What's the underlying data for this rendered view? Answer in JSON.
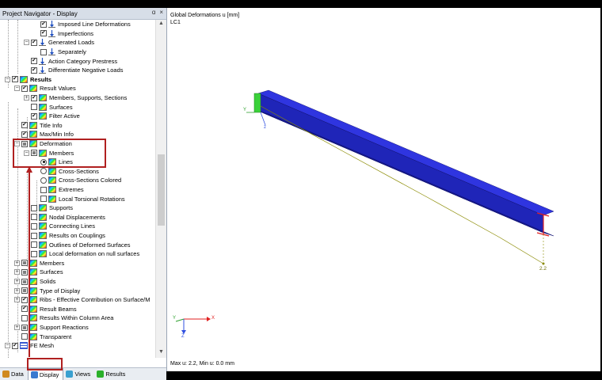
{
  "navigator": {
    "title": "Project Navigator - Display",
    "pin_glyph": "ɑ",
    "close_glyph": "×",
    "tree": [
      {
        "label": "Imposed Line Deformations",
        "depth": 3,
        "expander": "",
        "check": "on",
        "icon": "load",
        "bold": false
      },
      {
        "label": "Imperfections",
        "depth": 3,
        "expander": "",
        "check": "on",
        "icon": "load",
        "bold": false
      },
      {
        "label": "Generated Loads",
        "depth": 2,
        "expander": "-",
        "check": "on",
        "icon": "load",
        "bold": false
      },
      {
        "label": "Separately",
        "depth": 3,
        "expander": "",
        "check": "off",
        "icon": "load",
        "bold": false
      },
      {
        "label": "Action Category Prestress",
        "depth": 2,
        "expander": "",
        "check": "on",
        "icon": "load",
        "bold": false
      },
      {
        "label": "Differentiate Negative Loads",
        "depth": 2,
        "expander": "",
        "check": "on",
        "icon": "load",
        "bold": false
      },
      {
        "label": "Results",
        "depth": 0,
        "expander": "-",
        "check": "on",
        "icon": "res",
        "bold": true
      },
      {
        "label": "Result Values",
        "depth": 1,
        "expander": "-",
        "check": "on",
        "icon": "res",
        "bold": false
      },
      {
        "label": "Members, Supports, Sections",
        "depth": 2,
        "expander": "+",
        "check": "on",
        "icon": "res",
        "bold": false
      },
      {
        "label": "Surfaces",
        "depth": 2,
        "expander": "",
        "check": "off",
        "icon": "res",
        "bold": false
      },
      {
        "label": "Filter Active",
        "depth": 2,
        "expander": "",
        "check": "on",
        "icon": "res",
        "bold": false
      },
      {
        "label": "Title Info",
        "depth": 1,
        "expander": "",
        "check": "on",
        "icon": "res",
        "bold": false
      },
      {
        "label": "Max/Min Info",
        "depth": 1,
        "expander": "",
        "check": "on",
        "icon": "res",
        "bold": false
      },
      {
        "label": "Deformation",
        "depth": 1,
        "expander": "-",
        "check": "part",
        "icon": "res",
        "bold": false
      },
      {
        "label": "Members",
        "depth": 2,
        "expander": "-",
        "check": "part",
        "icon": "res",
        "bold": false
      },
      {
        "label": "Lines",
        "depth": 3,
        "expander": "",
        "check": "radio-on",
        "icon": "res",
        "bold": false
      },
      {
        "label": "Cross-Sections",
        "depth": 3,
        "expander": "",
        "check": "radio-off",
        "icon": "res",
        "bold": false
      },
      {
        "label": "Cross-Sections Colored",
        "depth": 3,
        "expander": "",
        "check": "radio-off",
        "icon": "res",
        "bold": false
      },
      {
        "label": "Extremes",
        "depth": 3,
        "expander": "",
        "check": "off",
        "icon": "res",
        "bold": false
      },
      {
        "label": "Local Torsional Rotations",
        "depth": 3,
        "expander": "",
        "check": "off",
        "icon": "res",
        "bold": false
      },
      {
        "label": "Supports",
        "depth": 2,
        "expander": "",
        "check": "off",
        "icon": "res",
        "bold": false
      },
      {
        "label": "Nodal Displacements",
        "depth": 2,
        "expander": "",
        "check": "off",
        "icon": "res",
        "bold": false
      },
      {
        "label": "Connecting Lines",
        "depth": 2,
        "expander": "",
        "check": "off",
        "icon": "res",
        "bold": false
      },
      {
        "label": "Results on Couplings",
        "depth": 2,
        "expander": "",
        "check": "off",
        "icon": "res",
        "bold": false
      },
      {
        "label": "Outlines of Deformed Surfaces",
        "depth": 2,
        "expander": "",
        "check": "off",
        "icon": "res",
        "bold": false
      },
      {
        "label": "Local deformation on null surfaces",
        "depth": 2,
        "expander": "",
        "check": "off",
        "icon": "res",
        "bold": false
      },
      {
        "label": "Members",
        "depth": 1,
        "expander": "+",
        "check": "part",
        "icon": "res",
        "bold": false
      },
      {
        "label": "Surfaces",
        "depth": 1,
        "expander": "+",
        "check": "part",
        "icon": "res",
        "bold": false
      },
      {
        "label": "Solids",
        "depth": 1,
        "expander": "+",
        "check": "part",
        "icon": "res",
        "bold": false
      },
      {
        "label": "Type of Display",
        "depth": 1,
        "expander": "+",
        "check": "part",
        "icon": "res",
        "bold": false
      },
      {
        "label": "Ribs - Effective Contribution on Surface/M",
        "depth": 1,
        "expander": "+",
        "check": "on",
        "icon": "res",
        "bold": false
      },
      {
        "label": "Result Beams",
        "depth": 1,
        "expander": "",
        "check": "on",
        "icon": "res",
        "bold": false
      },
      {
        "label": "Results Within Column Area",
        "depth": 1,
        "expander": "",
        "check": "off",
        "icon": "res",
        "bold": false
      },
      {
        "label": "Support Reactions",
        "depth": 1,
        "expander": "+",
        "check": "part",
        "icon": "res",
        "bold": false
      },
      {
        "label": "Transparent",
        "depth": 1,
        "expander": "",
        "check": "off",
        "icon": "res",
        "bold": false
      },
      {
        "label": "FE Mesh",
        "depth": 0,
        "expander": "-",
        "check": "on",
        "icon": "mesh",
        "bold": false
      }
    ],
    "tabs": [
      {
        "label": "Data",
        "icon": "data-icon",
        "active": false
      },
      {
        "label": "Display",
        "icon": "display-icon",
        "active": true
      },
      {
        "label": "Views",
        "icon": "views-icon",
        "active": false
      },
      {
        "label": "Results",
        "icon": "results-icon",
        "active": false
      }
    ]
  },
  "viewport": {
    "title_line1": "Global Deformations u [mm]",
    "title_line2": "LC1",
    "footer": "Max u: 2.2, Min u: 0.0 mm",
    "max_label": "2.2",
    "axis_x": "X",
    "axis_y": "Y",
    "axis_z": "Z",
    "beam_axis_y": "Y",
    "beam_axis_z": "z",
    "colors": {
      "beam_top": "#2a2fd6",
      "beam_side": "#1e22a8",
      "beam_dark": "#101070",
      "deform_line": "#8a8a00",
      "highlight": "#b02020"
    }
  }
}
